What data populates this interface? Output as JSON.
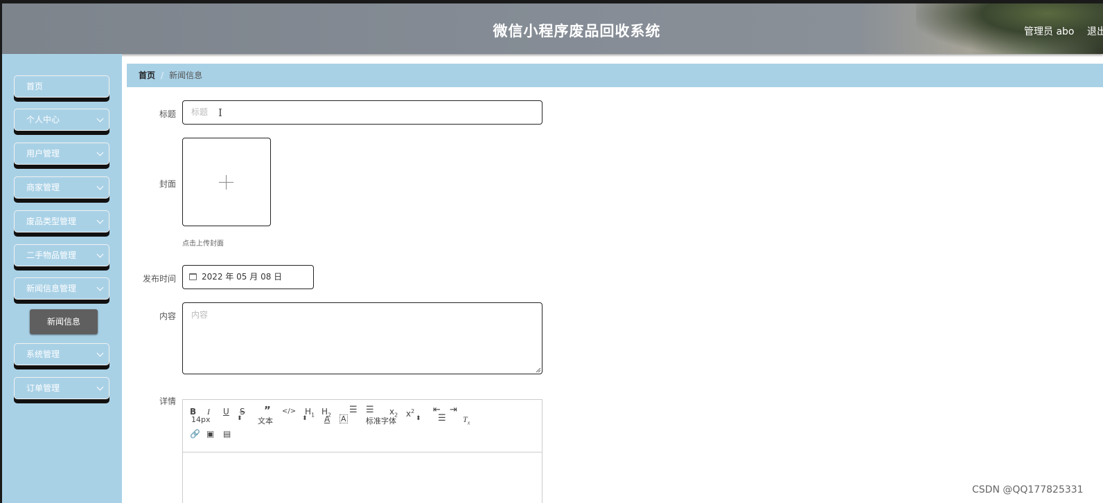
{
  "header": {
    "title": "微信小程序废品回收系统",
    "user": "管理员 abo",
    "logout": "退出"
  },
  "sidebar": {
    "items": [
      {
        "label": "首页",
        "has_children": false
      },
      {
        "label": "个人中心",
        "has_children": true
      },
      {
        "label": "用户管理",
        "has_children": true
      },
      {
        "label": "商家管理",
        "has_children": true
      },
      {
        "label": "废品类型管理",
        "has_children": true
      },
      {
        "label": "二手物品管理",
        "has_children": true
      },
      {
        "label": "新闻信息管理",
        "has_children": true,
        "expanded": true
      },
      {
        "label": "系统管理",
        "has_children": true
      },
      {
        "label": "订单管理",
        "has_children": true
      }
    ],
    "active_subitem": "新闻信息"
  },
  "breadcrumb": {
    "home": "首页",
    "separator": "/",
    "current": "新闻信息"
  },
  "form": {
    "title_label": "标题",
    "title_placeholder": "标题",
    "cover_label": "封面",
    "cover_hint": "点击上传封面",
    "time_label": "发布时间",
    "time_value": "2022 年 05 月 08 日",
    "content_label": "内容",
    "content_placeholder": "内容",
    "detail_label": "详情"
  },
  "editor": {
    "buttons": [
      "bold",
      "italic",
      "underline",
      "strike",
      "blockquote",
      "code-block",
      "header-1",
      "header-2",
      "ordered-list",
      "bullet-list",
      "subscript",
      "superscript",
      "outdent",
      "indent",
      "color",
      "background",
      "align",
      "clean",
      "link",
      "image",
      "video"
    ],
    "size_value": "14px",
    "header_value": "文本",
    "font_value": "标准字体"
  },
  "watermark": "CSDN @QQ177825331",
  "colors": {
    "sidebar_bg": "#a9d1e6",
    "active_bg": "#5f5f5f",
    "header_text": "#ffffff"
  }
}
